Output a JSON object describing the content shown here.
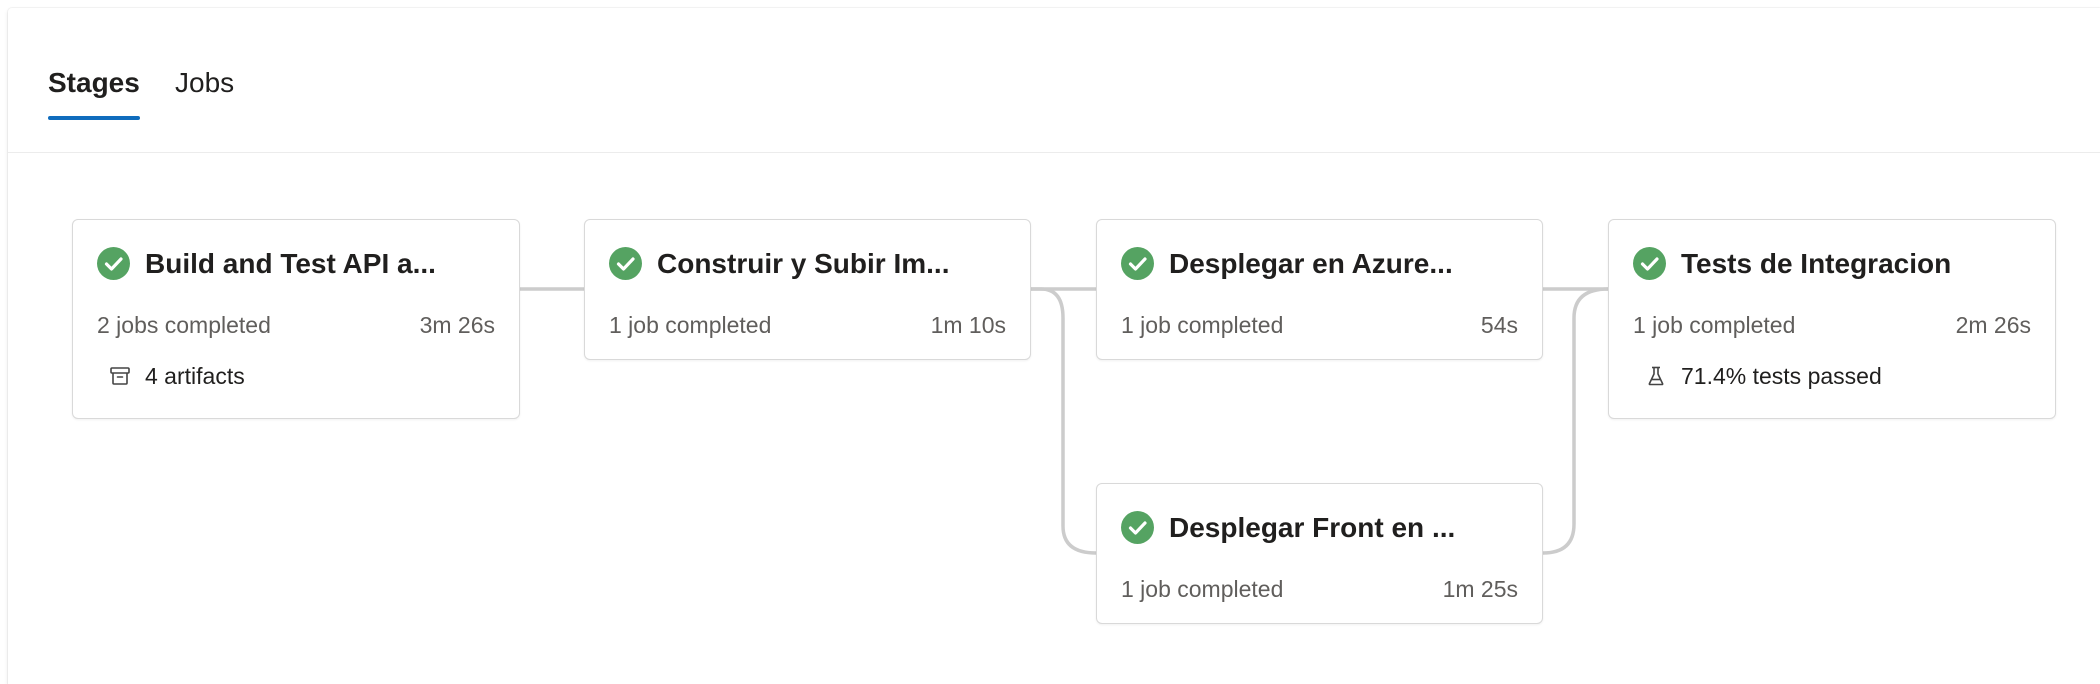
{
  "tabs": [
    {
      "label": "Stages",
      "selected": true
    },
    {
      "label": "Jobs",
      "selected": false
    }
  ],
  "colors": {
    "success": "#55a362",
    "accent": "#0f6cbd",
    "connector": "#cccccc"
  },
  "stages": [
    {
      "title": "Build and Test API a...",
      "status": "succeeded",
      "status_icon": "check-circle-icon",
      "jobs": "2 jobs completed",
      "duration": "3m 26s",
      "extra": {
        "icon": "artifact-icon",
        "text": "4 artifacts"
      }
    },
    {
      "title": "Construir y Subir Im...",
      "status": "succeeded",
      "status_icon": "check-circle-icon",
      "jobs": "1 job completed",
      "duration": "1m 10s"
    },
    {
      "title": "Desplegar en Azure...",
      "status": "succeeded",
      "status_icon": "check-circle-icon",
      "jobs": "1 job completed",
      "duration": "54s"
    },
    {
      "title": "Desplegar Front en ...",
      "status": "succeeded",
      "status_icon": "check-circle-icon",
      "jobs": "1 job completed",
      "duration": "1m 25s"
    },
    {
      "title": "Tests de Integracion",
      "status": "succeeded",
      "status_icon": "check-circle-icon",
      "jobs": "1 job completed",
      "duration": "2m 26s",
      "extra": {
        "icon": "flask-icon",
        "text": "71.4% tests passed"
      }
    }
  ]
}
